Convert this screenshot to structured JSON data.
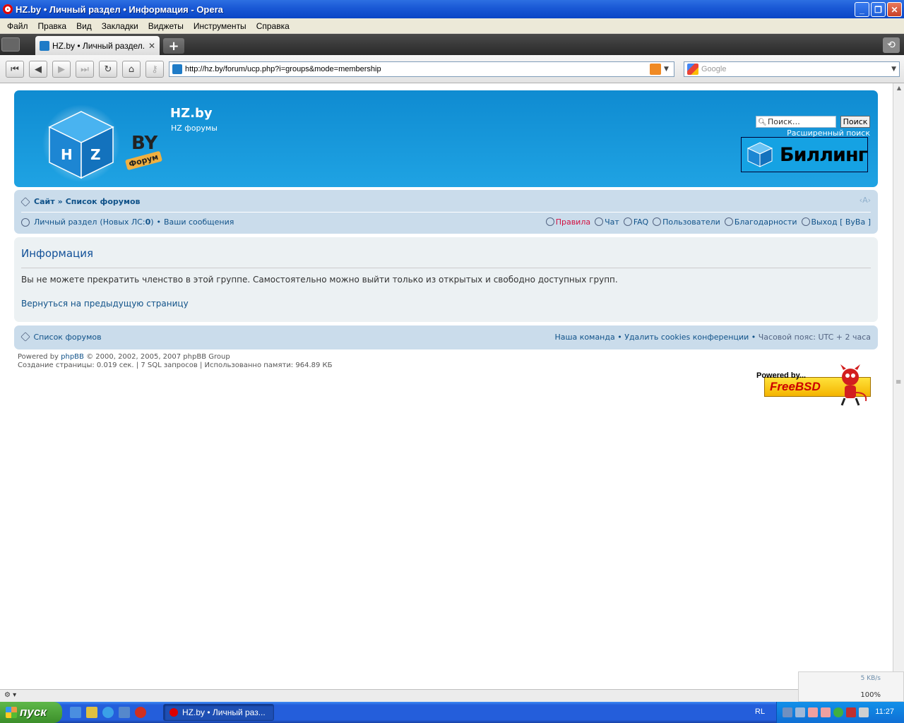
{
  "window": {
    "title": "HZ.by • Личный раздел • Информация - Opera",
    "buttons": [
      "_",
      "❐",
      "✕"
    ]
  },
  "menu": [
    "Файл",
    "Правка",
    "Вид",
    "Закладки",
    "Виджеты",
    "Инструменты",
    "Справка"
  ],
  "tabs": [
    {
      "label": "HZ.by • Личный раздел..."
    }
  ],
  "address": {
    "url": "http://hz.by/forum/ucp.php?i=groups&mode=membership"
  },
  "search": {
    "placeholder": "Google"
  },
  "header": {
    "site_title": "HZ.by",
    "site_desc": "HZ форумы",
    "search_placeholder": "Поиск…",
    "search_button": "Поиск",
    "advanced_search": "Расширенный поиск",
    "billing_label": "Биллинг",
    "logo_text_by": "BY",
    "logo_text_forum": "Форум"
  },
  "navbar": {
    "crumb_site": "Сайт",
    "crumb_sep": "»",
    "crumb_forums": "Список форумов",
    "font_size": "‹A›",
    "ucp": "Личный раздел",
    "new_pm_prefix": "(Новых ЛС: ",
    "new_pm_count": "0",
    "new_pm_suffix": ")",
    "bullet": "•",
    "your_posts": "Ваши сообщения",
    "rules": "Правила",
    "chat": "Чат",
    "faq": "FAQ",
    "users": "Пользователи",
    "thanks": "Благодарности",
    "logout": "Выход [ ByBa ]"
  },
  "panel": {
    "title": "Информация",
    "message": "Вы не можете прекратить членство в этой группе. Самостоятельно можно выйти только из открытых и свободно доступных групп.",
    "back_link": "Вернуться на предыдущую страницу"
  },
  "footer": {
    "forum_index": "Список форумов",
    "team": "Наша команда",
    "delete_cookies": "Удалить cookies конференции",
    "timezone": "Часовой пояс: UTC + 2 часа",
    "bullet": "•",
    "powered_prefix": "Powered by ",
    "powered_link": "phpBB",
    "powered_suffix": " © 2000, 2002, 2005, 2007 phpBB Group",
    "stats": "Создание страницы: 0.019 сек. | 7 SQL запросов | Использованно памяти: 964.89 КБ",
    "freebsd_powered": "Powered by...",
    "freebsd_name": "FreeBSD"
  },
  "statusbar": {
    "speed": "5 KB/s",
    "zoom": "100%"
  },
  "taskbar": {
    "start": "пуск",
    "task_label": "HZ.by • Личный раз...",
    "lang": "RL",
    "clock": "11:27"
  }
}
